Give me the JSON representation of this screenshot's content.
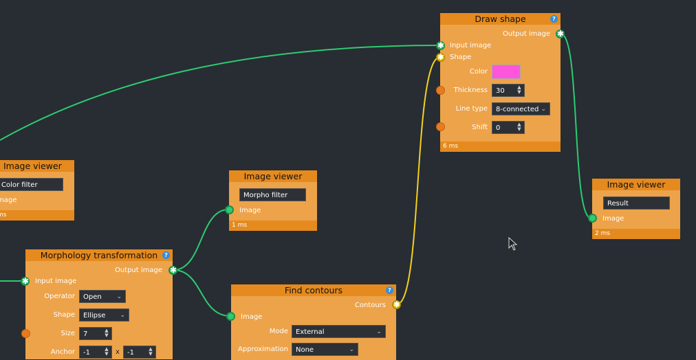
{
  "colors": {
    "background": "#272d33",
    "node_body": "#eda349",
    "node_header": "#e58a1e",
    "wire_image": "#2ecc71",
    "wire_shape": "#f5d020",
    "shape_color": "#ff55dd"
  },
  "nodes": {
    "draw_shape": {
      "title": "Draw shape",
      "help": "?",
      "output_image": "Output image",
      "input_image": "Input image",
      "shape": "Shape",
      "color_label": "Color",
      "thickness_label": "Thickness",
      "thickness_value": "30",
      "line_type_label": "Line type",
      "line_type_value": "8-connected",
      "shift_label": "Shift",
      "shift_value": "0",
      "footer": "6 ms"
    },
    "viewer_color": {
      "title": "Image viewer",
      "name_value": "Color filter",
      "image_label": "mage",
      "footer": "ms"
    },
    "viewer_morpho": {
      "title": "Image viewer",
      "name_value": "Morpho filter",
      "image_label": "Image",
      "footer": "1 ms"
    },
    "viewer_result": {
      "title": "Image viewer",
      "name_value": "Result",
      "image_label": "Image",
      "footer": "2 ms"
    },
    "morphology": {
      "title": "Morphology transformation",
      "help": "?",
      "output_image": "Output image",
      "input_image": "Input image",
      "operator_label": "Operator",
      "operator_value": "Open",
      "shape_label": "Shape",
      "shape_value": "Ellipse",
      "size_label": "Size",
      "size_value": "7",
      "anchor_label": "Anchor",
      "anchor_x": "-1",
      "anchor_sep": "x",
      "anchor_y": "-1"
    },
    "find_contours": {
      "title": "Find contours",
      "help": "?",
      "contours": "Contours",
      "image_label": "Image",
      "mode_label": "Mode",
      "mode_value": "External",
      "approx_label": "Approximation",
      "approx_value": "None"
    }
  },
  "icons": {
    "star": "✱",
    "chevron": "⌄",
    "spin_up": "▲",
    "spin_down": "▼"
  }
}
